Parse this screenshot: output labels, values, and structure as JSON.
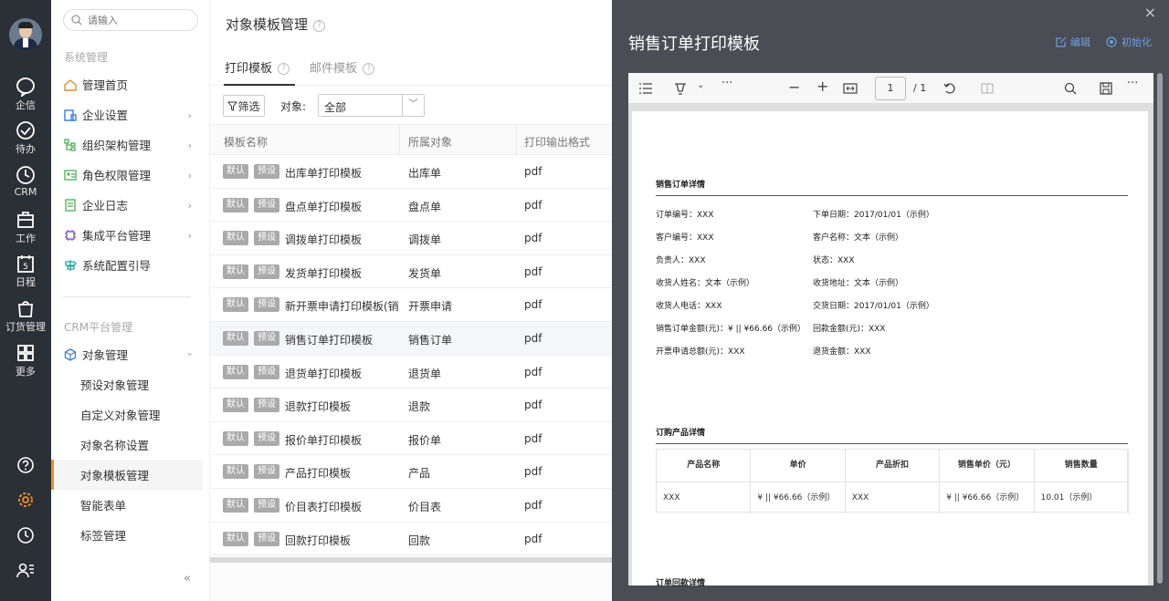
{
  "rail": {
    "items": [
      {
        "label": "企信",
        "icon": "chat-icon"
      },
      {
        "label": "待办",
        "icon": "check-circle-icon"
      },
      {
        "label": "CRM",
        "icon": "clock-icon"
      },
      {
        "label": "工作",
        "icon": "briefcase-icon"
      },
      {
        "label": "日程",
        "icon": "calendar-icon",
        "badge": "5"
      },
      {
        "label": "订货管理",
        "icon": "bag-icon"
      },
      {
        "label": "更多",
        "icon": "grid-icon"
      }
    ],
    "bottom_icons": [
      "help-icon",
      "settings-icon",
      "history-icon",
      "user-list-icon"
    ],
    "accent": "#f08c2a"
  },
  "sidebar": {
    "search_placeholder": "请输入",
    "section1": "系统管理",
    "items1": [
      {
        "label": "管理首页",
        "icon": "home-icon"
      },
      {
        "label": "企业设置",
        "icon": "building-icon"
      },
      {
        "label": "组织架构管理",
        "icon": "org-icon"
      },
      {
        "label": "角色权限管理",
        "icon": "role-icon"
      },
      {
        "label": "企业日志",
        "icon": "log-icon"
      },
      {
        "label": "集成平台管理",
        "icon": "chip-icon"
      },
      {
        "label": "系统配置引导",
        "icon": "signpost-icon"
      }
    ],
    "section2": "CRM平台管理",
    "object_mgmt": "对象管理",
    "sub_items": [
      "预设对象管理",
      "自定义对象管理",
      "对象名称设置",
      "对象模板管理",
      "智能表单",
      "标签管理"
    ],
    "collapse": "«"
  },
  "main": {
    "title": "对象模板管理",
    "tabs": [
      "打印模板",
      "邮件模板"
    ],
    "filter_label": "筛选",
    "object_label": "对象:",
    "object_value": "全部",
    "columns": [
      "模板名称",
      "所属对象",
      "打印输出格式"
    ],
    "tag_default": "默认",
    "tag_preset": "预设",
    "rows": [
      {
        "name": "出库单打印模板",
        "object": "出库单",
        "format": "pdf"
      },
      {
        "name": "盘点单打印模板",
        "object": "盘点单",
        "format": "pdf"
      },
      {
        "name": "调拨单打印模板",
        "object": "调拨单",
        "format": "pdf"
      },
      {
        "name": "发货单打印模板",
        "object": "发货单",
        "format": "pdf"
      },
      {
        "name": "新开票申请打印模板(销售订",
        "object": "开票申请",
        "format": "pdf"
      },
      {
        "name": "销售订单打印模板",
        "object": "销售订单",
        "format": "pdf"
      },
      {
        "name": "退货单打印模板",
        "object": "退货单",
        "format": "pdf"
      },
      {
        "name": "退款打印模板",
        "object": "退款",
        "format": "pdf"
      },
      {
        "name": "报价单打印模板",
        "object": "报价单",
        "format": "pdf"
      },
      {
        "name": "产品打印模板",
        "object": "产品",
        "format": "pdf"
      },
      {
        "name": "价目表打印模板",
        "object": "价目表",
        "format": "pdf"
      },
      {
        "name": "回款打印模板",
        "object": "回款",
        "format": "pdf"
      }
    ]
  },
  "drawer": {
    "title": "销售订单打印模板",
    "edit": "编辑",
    "init": "初始化",
    "close": "×",
    "toolbar": {
      "page": "1",
      "total": "/ 1"
    },
    "pdf": {
      "section1": "销售订单详情",
      "fields_left": [
        "订单编号：XXX",
        "客户编号：XXX",
        "负责人：XXX",
        "收货人姓名：文本（示例）",
        "收货人电话：XXX",
        "销售订单金额(元)：¥ || ¥66.66（示例）",
        "开票申请总额(元)：XXX"
      ],
      "fields_right": [
        "下单日期：2017/01/01（示例）",
        "客户名称：文本（示例）",
        "状态：XXX",
        "收货地址：文本（示例）",
        "交货日期：2017/01/01（示例）",
        "回款金额(元)：XXX",
        "退货金额：XXX"
      ],
      "section2": "订购产品详情",
      "table_headers": [
        "产品名称",
        "单价",
        "产品折扣",
        "销售单价（元）",
        "销售数量"
      ],
      "table_row": [
        "XXX",
        "¥ || ¥66.66（示例）",
        "XXX",
        "¥ || ¥66.66（示例）",
        "10.01（示例）"
      ],
      "section3": "订单回款详情"
    }
  }
}
